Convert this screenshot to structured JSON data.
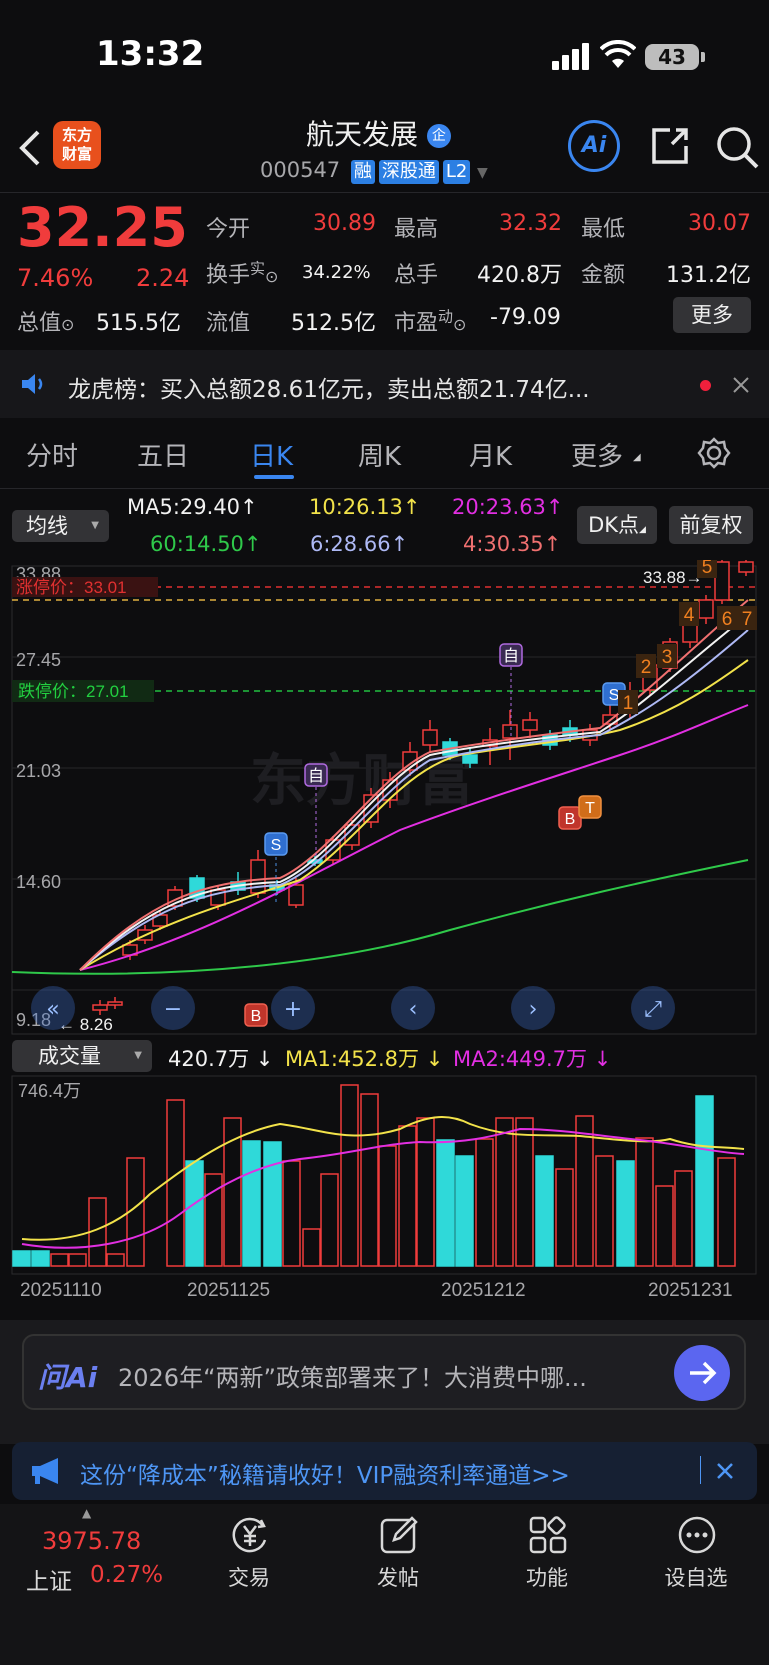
{
  "status_bar": {
    "time": "13:32",
    "battery": "43"
  },
  "header": {
    "logo_line1": "东方",
    "logo_line2": "财富",
    "stock_name": "航天发展",
    "name_badge": "企",
    "stock_code": "000547",
    "tags": [
      "融",
      "深股通",
      "L2"
    ],
    "ai_label": "Ai"
  },
  "quote": {
    "price": "32.25",
    "change_pct": "7.46%",
    "change": "2.24",
    "open_label": "今开",
    "open": "30.89",
    "high_label": "最高",
    "high": "32.32",
    "low_label": "最低",
    "low": "30.07",
    "turnover_label": "换手",
    "turnover_sup": "实",
    "turnover": "34.22%",
    "volume_label": "总手",
    "volume": "420.8万",
    "amount_label": "金额",
    "amount": "131.2亿",
    "mktcap_label": "总值",
    "mktcap": "515.5亿",
    "float_label": "流值",
    "float_cap": "512.5亿",
    "pe_label": "市盈",
    "pe_sup": "动",
    "pe": "-79.09",
    "more_label": "更多"
  },
  "news_ticker": {
    "text": "龙虎榜：买入总额28.61亿元，卖出总额21.74亿..."
  },
  "tabs": [
    "分时",
    "五日",
    "日K",
    "周K",
    "月K",
    "更多"
  ],
  "active_tab": "日K",
  "indicator": {
    "ma_select": "均线",
    "ma5": "MA5:29.40",
    "ma10": "10:26.13",
    "ma20": "20:23.63",
    "ma60": "60:14.50",
    "ma6": "6:28.66",
    "ma4": "4:30.35",
    "dk_label": "DK点",
    "adjust_label": "前复权"
  },
  "kline": {
    "y_labels": [
      "33.88",
      "27.45",
      "21.03",
      "14.60",
      "9.18"
    ],
    "limit_up": "涨停价：33.01",
    "limit_down": "跌停价：27.01",
    "high_mark": "33.88→",
    "low_mark": "← 8.26",
    "marker_self": "自",
    "marker_s": "S",
    "marker_b": "B",
    "marker_t": "T",
    "seq": [
      "1",
      "2",
      "3",
      "4",
      "5",
      "6",
      "7"
    ],
    "watermark": "东方财富"
  },
  "volume_panel": {
    "select": "成交量",
    "vol": "420.7万",
    "ma1": "MA1:452.8万",
    "ma2": "MA2:449.7万",
    "max_label": "746.4万",
    "dates": [
      "20251110",
      "20251125",
      "20251212",
      "20251231"
    ]
  },
  "ai_bar": {
    "logo": "问Ai",
    "text": "2026年“两新”政策部署来了！大消费中哪..."
  },
  "promo": {
    "text": "这份“降成本”秘籍请收好！VIP融资利率通道>>"
  },
  "bottom_nav": {
    "index_value": "3975.78",
    "index_name": "上证",
    "index_pct": "0.27%",
    "items": [
      "交易",
      "发帖",
      "功能",
      "设自选"
    ]
  },
  "colors": {
    "up": "#f03c3c",
    "down": "#2fd9d9",
    "accent": "#3a86f0",
    "bg": "#0d0d0f"
  }
}
